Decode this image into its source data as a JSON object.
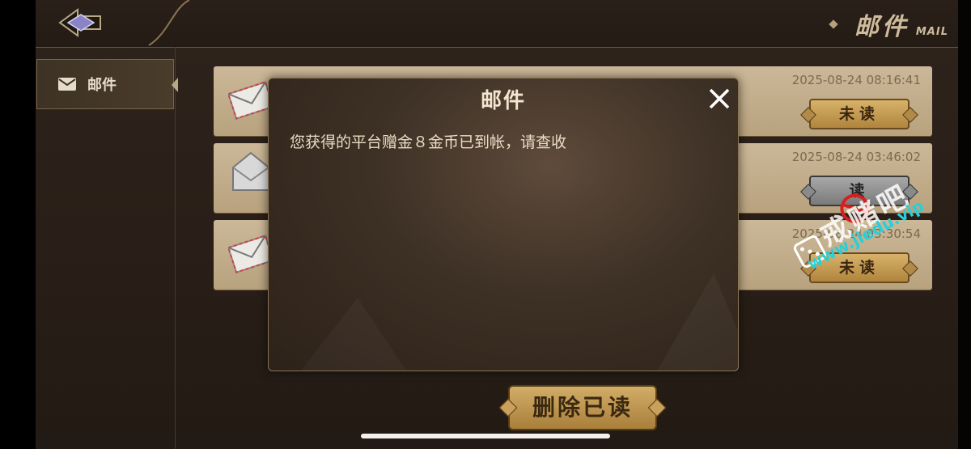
{
  "header": {
    "title": "邮件",
    "title_en": "MAIL"
  },
  "sidebar": {
    "items": [
      {
        "label": "邮件",
        "icon": "mail-icon",
        "selected": true
      }
    ]
  },
  "mails": [
    {
      "time": "2025-08-24 08:16:41",
      "status": "未读",
      "state": "unread"
    },
    {
      "time": "2025-08-24 03:46:02",
      "status": "读",
      "state": "read"
    },
    {
      "time": "2025-08-24 03:30:54",
      "status": "未读",
      "state": "unread"
    }
  ],
  "actions": {
    "delete_read": "删除已读"
  },
  "modal": {
    "title": "邮件",
    "body": "您获得的平台赠金８金币已到帐，请查收"
  },
  "watermark": {
    "main": "戒赌吧",
    "url": "www.jiedu.vip"
  },
  "colors": {
    "accent_gold": "#c9a25c",
    "panel_tan": "#c2ad8b",
    "text_light": "#e9dcc4"
  }
}
